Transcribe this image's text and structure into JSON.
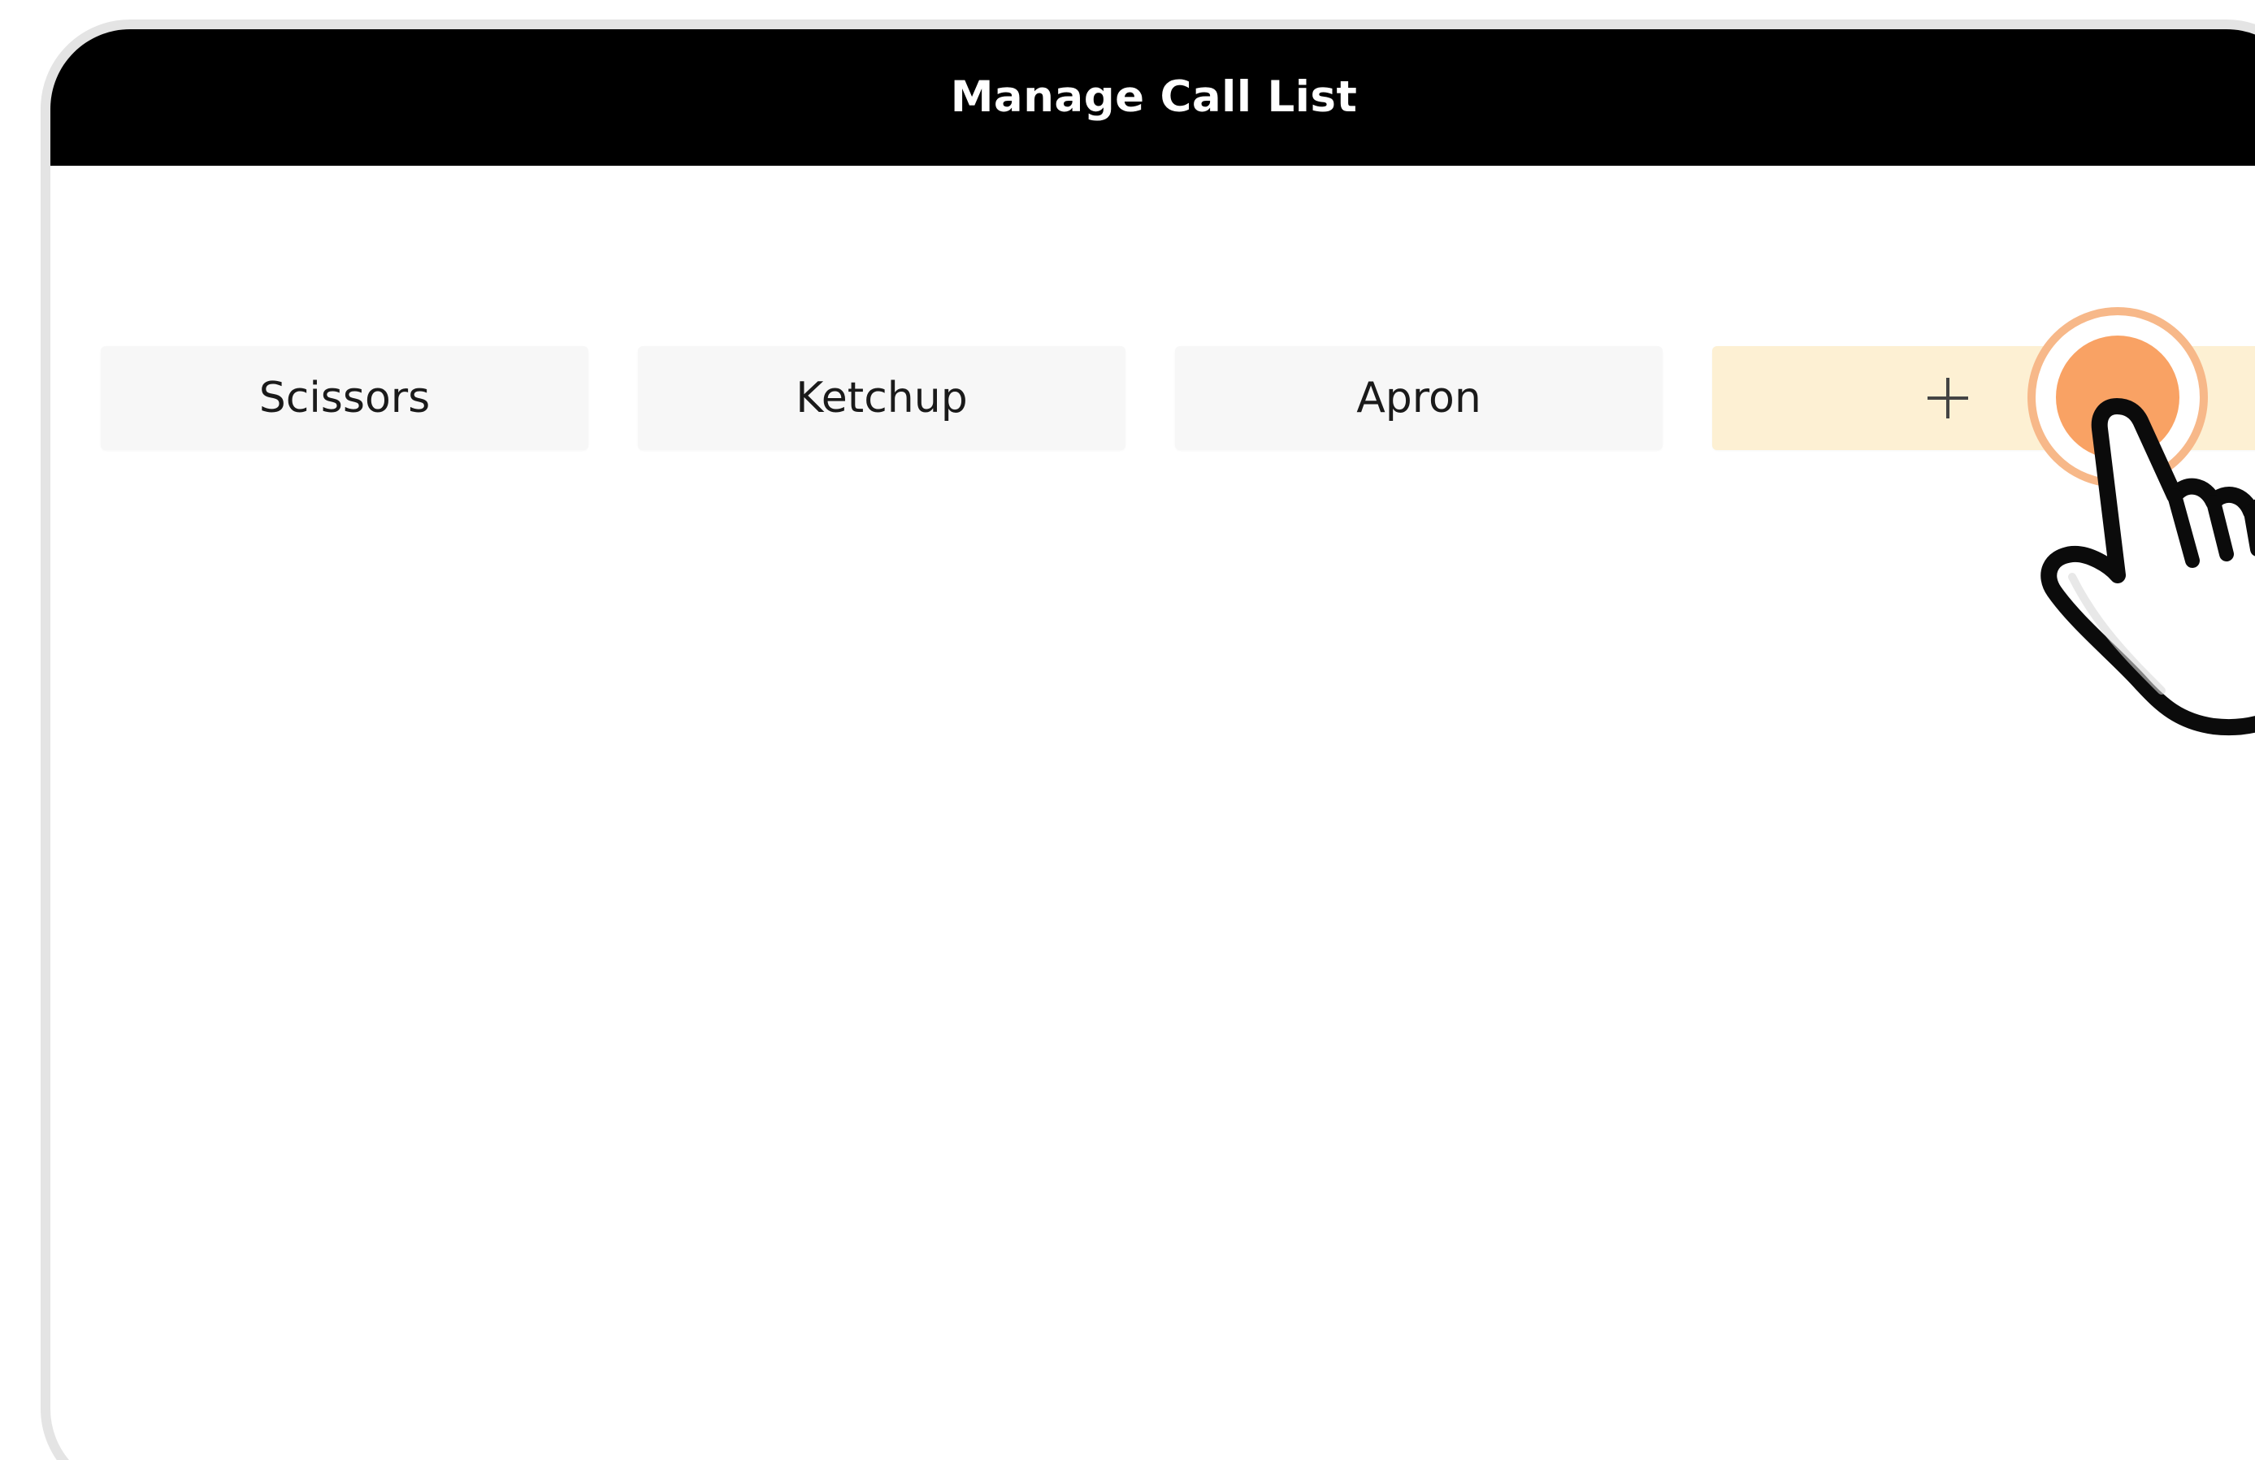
{
  "header": {
    "title": "Manage Call List"
  },
  "call_list": {
    "items": [
      {
        "label": "Scissors"
      },
      {
        "label": "Ketchup"
      },
      {
        "label": "Apron"
      }
    ],
    "add_button": {
      "icon": "plus-icon"
    }
  },
  "gesture": {
    "icon": "tap-hand-icon",
    "accent_color": "#f9a264",
    "ring_color": "#f7b889"
  },
  "colors": {
    "header_bg": "#000000",
    "item_bg": "#f7f7f7",
    "add_bg": "#fdf0d3"
  }
}
